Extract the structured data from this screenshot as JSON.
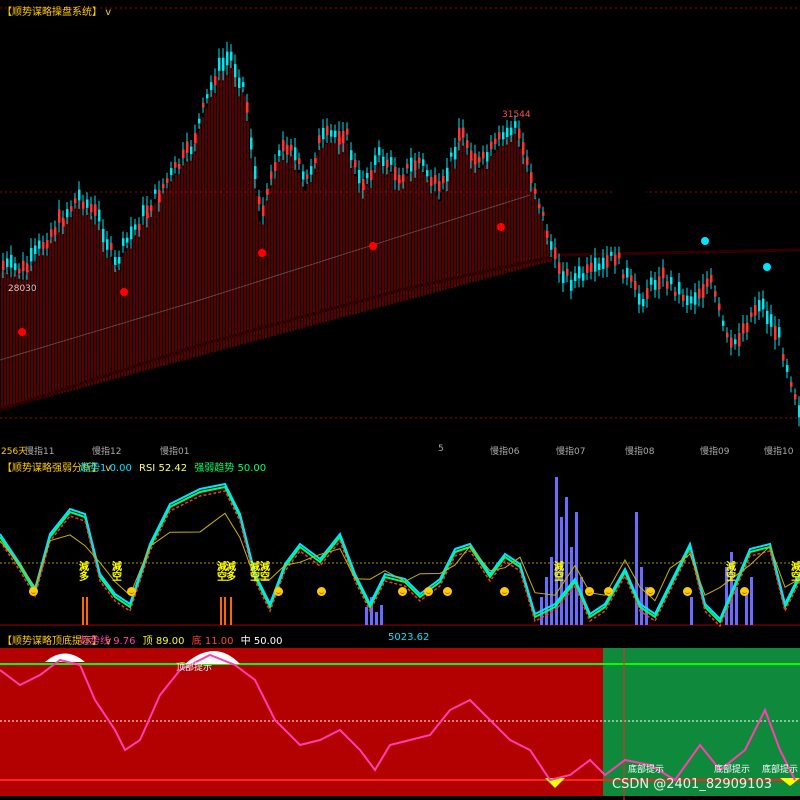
{
  "colors": {
    "bg": "#000000",
    "upCandle": "#00e5ee",
    "downCandle": "#00e5ee",
    "redBar": "#b00000",
    "greenBar": "#1f8a1f",
    "redDot": "#ff0000",
    "cyanDot": "#00e5ff",
    "signalRed": "#b30000",
    "signalGreen": "#0f8a3c",
    "magenta": "#ff3fb0",
    "yellow": "#ffff00"
  },
  "main_pane": {
    "title": "【顺势谋略操盘系统】",
    "chevron": "v",
    "high_label": "31544",
    "low_label": "28030"
  },
  "time_axis": {
    "days": "256天",
    "labels": [
      "慢指11",
      "慢指12",
      "慢指01",
      "5",
      "慢指06",
      "慢指07",
      "慢指08",
      "慢指09",
      "慢指10"
    ]
  },
  "strength_pane": {
    "title": "【顺势谋略强弱分析】",
    "chevron": "v",
    "legend": [
      {
        "name": "趋势1",
        "value": "0.00",
        "color": "#00e5ff"
      },
      {
        "name": "RSI",
        "value": "52.42",
        "color": "#ffff66"
      },
      {
        "name": "强弱趋势",
        "value": "50.00",
        "color": "#00ff66"
      }
    ],
    "signals": [
      "減多",
      "減空",
      "減空",
      "減多",
      "減空",
      "減空",
      "減空",
      "減空",
      "減空"
    ]
  },
  "signal_pane": {
    "title": "【顺势谋略顶底提示】",
    "chevron": "v",
    "legend": [
      {
        "name": "趋势线",
        "value": "9.76",
        "color": "#ff3fb0"
      },
      {
        "name": "顶",
        "value": "89.00",
        "color": "#ffff00"
      },
      {
        "name": "底",
        "value": "11.00",
        "color": "#ff4040"
      },
      {
        "name": "中",
        "value": "50.00",
        "color": "#ffffff"
      }
    ],
    "center_value": "5023.62",
    "top_hint": "顶部提示",
    "bottom_hints": [
      "底部提示",
      "底部提示",
      "底部提示"
    ]
  },
  "watermark": "CSDN @2401_82909103"
}
